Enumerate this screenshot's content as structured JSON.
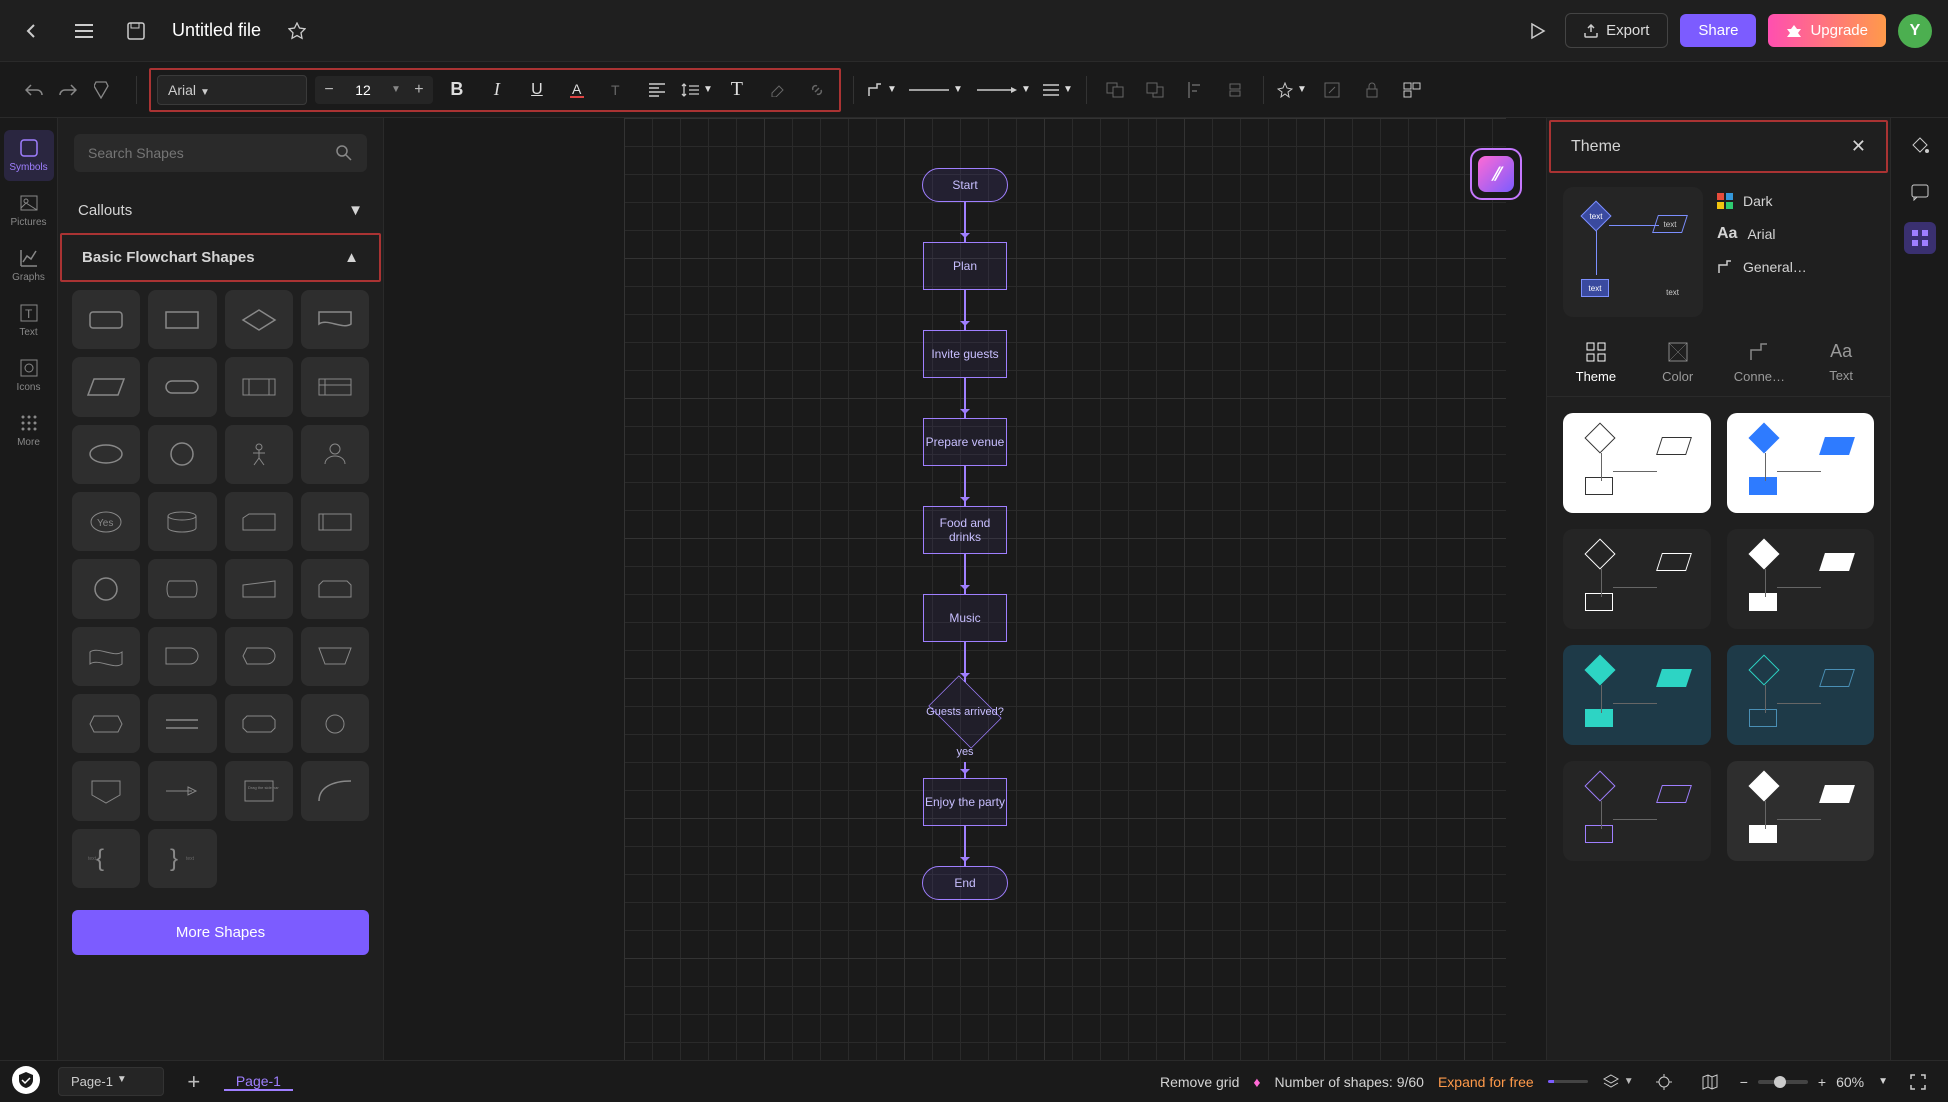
{
  "header": {
    "file_title": "Untitled file",
    "export": "Export",
    "share": "Share",
    "upgrade": "Upgrade",
    "avatar_initial": "Y"
  },
  "toolbar": {
    "font": "Arial",
    "font_size": "12"
  },
  "left_rail": [
    {
      "id": "symbols",
      "label": "Symbols",
      "active": true
    },
    {
      "id": "pictures",
      "label": "Pictures",
      "active": false
    },
    {
      "id": "graphs",
      "label": "Graphs",
      "active": false
    },
    {
      "id": "text",
      "label": "Text",
      "active": false
    },
    {
      "id": "icons",
      "label": "Icons",
      "active": false
    },
    {
      "id": "more",
      "label": "More",
      "active": false
    }
  ],
  "shapes_panel": {
    "search_placeholder": "Search Shapes",
    "sections": {
      "callouts": "Callouts",
      "basic_flowchart": "Basic Flowchart Shapes"
    },
    "yes_shape_label": "Yes",
    "more_shapes": "More Shapes"
  },
  "flowchart": {
    "nodes": [
      {
        "id": "start",
        "type": "terminal",
        "text": "Start"
      },
      {
        "id": "plan",
        "type": "process",
        "text": "Plan"
      },
      {
        "id": "invite",
        "type": "process",
        "text": "Invite guests"
      },
      {
        "id": "venue",
        "type": "process",
        "text": "Prepare venue"
      },
      {
        "id": "food",
        "type": "process",
        "text": "Food and drinks"
      },
      {
        "id": "music",
        "type": "process",
        "text": "Music"
      },
      {
        "id": "arrived",
        "type": "decision",
        "text": "Guests arrived?"
      },
      {
        "id": "enjoy",
        "type": "process",
        "text": "Enjoy the party"
      },
      {
        "id": "end",
        "type": "terminal",
        "text": "End"
      }
    ],
    "decision_label": "yes"
  },
  "theme_panel": {
    "title": "Theme",
    "preview_labels": [
      "text",
      "text",
      "text",
      "text"
    ],
    "meta": {
      "color_mode": "Dark",
      "font": "Arial",
      "connector_style": "General…"
    },
    "tabs": [
      {
        "id": "theme",
        "label": "Theme",
        "active": true
      },
      {
        "id": "color",
        "label": "Color",
        "active": false
      },
      {
        "id": "connector",
        "label": "Conne…",
        "active": false
      },
      {
        "id": "text",
        "label": "Text",
        "active": false
      }
    ],
    "themes": [
      {
        "bg": "#ffffff",
        "shape": "#333",
        "para": "#333",
        "rect": "#333",
        "mode": "outline"
      },
      {
        "bg": "#ffffff",
        "shape": "#2e7bff",
        "para": "#2e7bff",
        "rect": "#2e7bff",
        "mode": "fill"
      },
      {
        "bg": "#252525",
        "shape": "#fff",
        "para": "#fff",
        "rect": "#fff",
        "mode": "outline"
      },
      {
        "bg": "#252525",
        "shape": "#fff",
        "para": "#fff",
        "rect": "#fff",
        "mode": "fill"
      },
      {
        "bg": "#1e3a48",
        "shape": "#2dd4c4",
        "para": "#2dd4c4",
        "rect": "#2dd4c4",
        "mode": "fill"
      },
      {
        "bg": "#1e3a48",
        "shape": "#2dd4c4",
        "para": "#4a8fb5",
        "rect": "#4a8fb5",
        "mode": "outline"
      },
      {
        "bg": "#252525",
        "shape": "#9f7fff",
        "para": "#9f7fff",
        "rect": "#9f7fff",
        "mode": "outline"
      },
      {
        "bg": "#2e2e2e",
        "shape": "#fff",
        "para": "#fff",
        "rect": "#fff",
        "mode": "fill"
      }
    ]
  },
  "bottombar": {
    "page_select": "Page-1",
    "page_tab": "Page-1",
    "remove_grid": "Remove grid",
    "shapes_count_prefix": "Number of shapes: ",
    "shapes_count": "9/60",
    "expand": "Expand for free",
    "zoom": "60%"
  }
}
